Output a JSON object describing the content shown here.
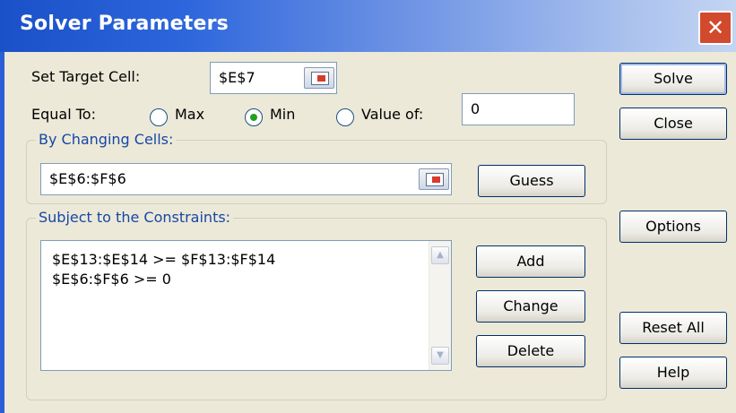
{
  "window": {
    "title": "Solver Parameters",
    "close_glyph": "✕",
    "close_icon": "close-icon"
  },
  "target": {
    "label": "Set Target Cell:",
    "value": "$E$7",
    "picker_icon": "range-collapse-icon"
  },
  "equal_to": {
    "label": "Equal To:",
    "options": [
      {
        "label": "Max",
        "checked": false
      },
      {
        "label": "Min",
        "checked": true
      },
      {
        "label": "Value of:",
        "checked": false
      }
    ],
    "value_of": "0"
  },
  "changing": {
    "group_label": "By Changing Cells:",
    "value": "$E$6:$F$6",
    "guess_label": "Guess",
    "picker_icon": "range-collapse-icon"
  },
  "constraints": {
    "group_label": "Subject to the Constraints:",
    "items": [
      "$E$13:$E$14 >= $F$13:$F$14",
      "$E$6:$F$6 >= 0"
    ],
    "add_label": "Add",
    "change_label": "Change",
    "delete_label": "Delete"
  },
  "side_buttons": {
    "solve": "Solve",
    "close": "Close",
    "options": "Options",
    "reset_all": "Reset All",
    "help": "Help"
  },
  "colors": {
    "title_start": "#1a50c8",
    "title_end": "#c4d5f2",
    "dialog_bg": "#ece9d8",
    "group_label_text": "#1747a6",
    "close_button": "#d24a2d",
    "radio_dot": "#21a121"
  }
}
